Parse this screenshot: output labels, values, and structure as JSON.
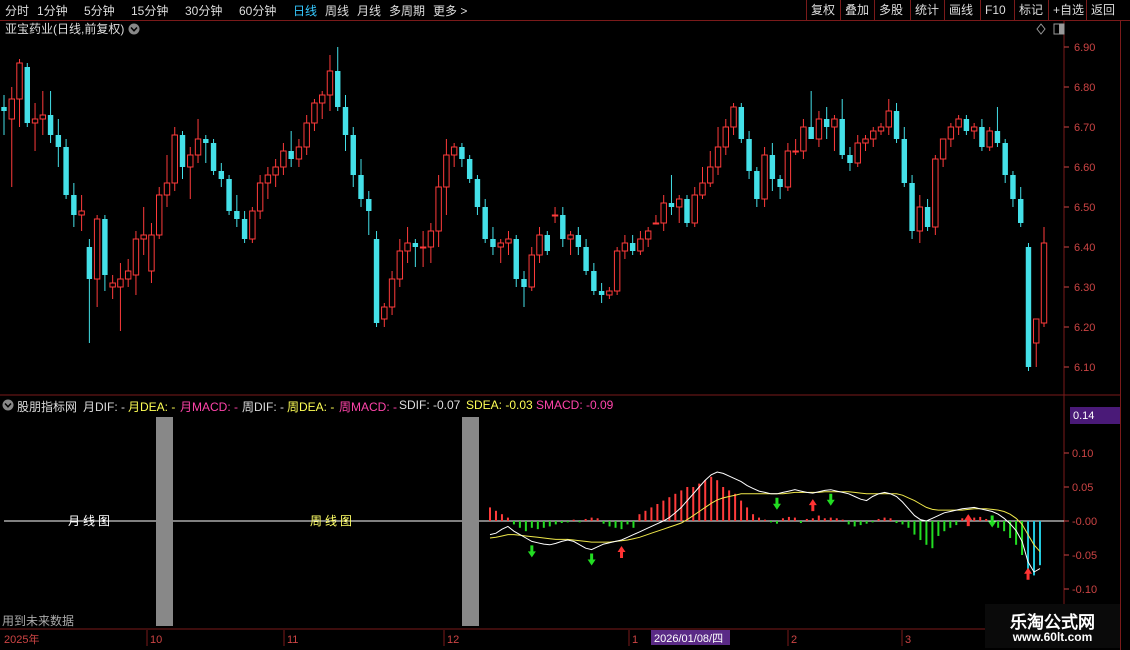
{
  "toolbar": {
    "periods": [
      "分时",
      "1分钟",
      "5分钟",
      "15分钟",
      "30分钟",
      "60分钟",
      "日线",
      "周线",
      "月线",
      "多周期",
      "更多 >"
    ],
    "active_period": "日线",
    "right_buttons": [
      "复权",
      "叠加",
      "多股",
      "统计",
      "画线",
      "F10",
      "标记",
      "+自选",
      "返回"
    ]
  },
  "main_chart": {
    "title": "亚宝药业(日线,前复权)",
    "ylim": [
      6.05,
      6.95
    ],
    "yticks": [
      "6.90",
      "6.80",
      "6.70",
      "6.60",
      "6.50",
      "6.40",
      "6.30",
      "6.20",
      "6.10"
    ]
  },
  "indicator": {
    "name": "股朋指标网",
    "labels": [
      {
        "text": "月DIF: -",
        "color": "#dddddd"
      },
      {
        "text": "月DEA: -",
        "color": "#ffff55"
      },
      {
        "text": "月MACD: -",
        "color": "#ff44aa"
      },
      {
        "text": "周DIF: -",
        "color": "#dddddd"
      },
      {
        "text": "周DEA: -",
        "color": "#ffff55"
      },
      {
        "text": "周MACD: -",
        "color": "#ff44aa"
      },
      {
        "text": "SDIF: -0.07",
        "color": "#dddddd"
      },
      {
        "text": "SDEA: -0.03",
        "color": "#ffff55"
      },
      {
        "text": "SMACD: -0.09",
        "color": "#ff44aa"
      }
    ],
    "yticks": [
      "0.10",
      "0.05",
      "-0.00",
      "-0.05",
      "-0.10"
    ],
    "top_value": "0.14",
    "month_label": "月线图",
    "week_label": "周线图",
    "future_note": "用到未来数据"
  },
  "time_axis": {
    "labels": [
      "2025年",
      "10",
      "11",
      "12",
      "1",
      "2",
      "3"
    ],
    "cursor_date": "2026/01/08/四"
  },
  "watermark": {
    "line1": "乐淘公式网",
    "line2": "www.60lt.com"
  },
  "colors": {
    "up": "#ff3b3b",
    "down": "#44e0e8",
    "bg": "#000000",
    "grid": "#7a1a1a",
    "active": "#35c8ff"
  },
  "chart_data": {
    "type": "candlestick",
    "series": [
      {
        "o": 6.75,
        "h": 6.78,
        "l": 6.68,
        "c": 6.74
      },
      {
        "o": 6.72,
        "h": 6.8,
        "l": 6.55,
        "c": 6.77
      },
      {
        "o": 6.77,
        "h": 6.87,
        "l": 6.7,
        "c": 6.86
      },
      {
        "o": 6.85,
        "h": 6.86,
        "l": 6.7,
        "c": 6.71
      },
      {
        "o": 6.71,
        "h": 6.76,
        "l": 6.64,
        "c": 6.72
      },
      {
        "o": 6.72,
        "h": 6.79,
        "l": 6.68,
        "c": 6.73
      },
      {
        "o": 6.73,
        "h": 6.79,
        "l": 6.66,
        "c": 6.68
      },
      {
        "o": 6.68,
        "h": 6.72,
        "l": 6.6,
        "c": 6.65
      },
      {
        "o": 6.65,
        "h": 6.67,
        "l": 6.52,
        "c": 6.53
      },
      {
        "o": 6.53,
        "h": 6.56,
        "l": 6.45,
        "c": 6.48
      },
      {
        "o": 6.48,
        "h": 6.53,
        "l": 6.44,
        "c": 6.49
      },
      {
        "o": 6.4,
        "h": 6.42,
        "l": 6.16,
        "c": 6.32
      },
      {
        "o": 6.32,
        "h": 6.48,
        "l": 6.25,
        "c": 6.47
      },
      {
        "o": 6.47,
        "h": 6.48,
        "l": 6.29,
        "c": 6.33
      },
      {
        "o": 6.3,
        "h": 6.33,
        "l": 6.27,
        "c": 6.31
      },
      {
        "o": 6.3,
        "h": 6.36,
        "l": 6.19,
        "c": 6.32
      },
      {
        "o": 6.32,
        "h": 6.37,
        "l": 6.3,
        "c": 6.34
      },
      {
        "o": 6.33,
        "h": 6.44,
        "l": 6.28,
        "c": 6.42
      },
      {
        "o": 6.42,
        "h": 6.5,
        "l": 6.38,
        "c": 6.43
      },
      {
        "o": 6.34,
        "h": 6.46,
        "l": 6.31,
        "c": 6.43
      },
      {
        "o": 6.43,
        "h": 6.55,
        "l": 6.42,
        "c": 6.53
      },
      {
        "o": 6.53,
        "h": 6.63,
        "l": 6.5,
        "c": 6.56
      },
      {
        "o": 6.56,
        "h": 6.7,
        "l": 6.54,
        "c": 6.68
      },
      {
        "o": 6.68,
        "h": 6.69,
        "l": 6.57,
        "c": 6.6
      },
      {
        "o": 6.6,
        "h": 6.65,
        "l": 6.52,
        "c": 6.63
      },
      {
        "o": 6.63,
        "h": 6.72,
        "l": 6.61,
        "c": 6.67
      },
      {
        "o": 6.67,
        "h": 6.68,
        "l": 6.61,
        "c": 6.66
      },
      {
        "o": 6.66,
        "h": 6.67,
        "l": 6.58,
        "c": 6.59
      },
      {
        "o": 6.59,
        "h": 6.61,
        "l": 6.55,
        "c": 6.57
      },
      {
        "o": 6.57,
        "h": 6.58,
        "l": 6.48,
        "c": 6.49
      },
      {
        "o": 6.49,
        "h": 6.53,
        "l": 6.45,
        "c": 6.47
      },
      {
        "o": 6.47,
        "h": 6.49,
        "l": 6.41,
        "c": 6.42
      },
      {
        "o": 6.42,
        "h": 6.5,
        "l": 6.41,
        "c": 6.49
      },
      {
        "o": 6.49,
        "h": 6.58,
        "l": 6.47,
        "c": 6.56
      },
      {
        "o": 6.56,
        "h": 6.6,
        "l": 6.52,
        "c": 6.58
      },
      {
        "o": 6.58,
        "h": 6.62,
        "l": 6.55,
        "c": 6.6
      },
      {
        "o": 6.6,
        "h": 6.66,
        "l": 6.58,
        "c": 6.64
      },
      {
        "o": 6.64,
        "h": 6.69,
        "l": 6.6,
        "c": 6.62
      },
      {
        "o": 6.62,
        "h": 6.67,
        "l": 6.6,
        "c": 6.65
      },
      {
        "o": 6.65,
        "h": 6.73,
        "l": 6.63,
        "c": 6.71
      },
      {
        "o": 6.71,
        "h": 6.77,
        "l": 6.69,
        "c": 6.76
      },
      {
        "o": 6.76,
        "h": 6.79,
        "l": 6.72,
        "c": 6.78
      },
      {
        "o": 6.78,
        "h": 6.88,
        "l": 6.74,
        "c": 6.84
      },
      {
        "o": 6.84,
        "h": 6.9,
        "l": 6.74,
        "c": 6.75
      },
      {
        "o": 6.75,
        "h": 6.78,
        "l": 6.64,
        "c": 6.68
      },
      {
        "o": 6.68,
        "h": 6.7,
        "l": 6.55,
        "c": 6.58
      },
      {
        "o": 6.58,
        "h": 6.62,
        "l": 6.5,
        "c": 6.52
      },
      {
        "o": 6.52,
        "h": 6.54,
        "l": 6.43,
        "c": 6.49
      },
      {
        "o": 6.42,
        "h": 6.44,
        "l": 6.2,
        "c": 6.21
      },
      {
        "o": 6.22,
        "h": 6.26,
        "l": 6.2,
        "c": 6.25
      },
      {
        "o": 6.25,
        "h": 6.34,
        "l": 6.23,
        "c": 6.32
      },
      {
        "o": 6.32,
        "h": 6.42,
        "l": 6.3,
        "c": 6.39
      },
      {
        "o": 6.39,
        "h": 6.45,
        "l": 6.36,
        "c": 6.41
      },
      {
        "o": 6.41,
        "h": 6.42,
        "l": 6.35,
        "c": 6.4
      },
      {
        "o": 6.4,
        "h": 6.44,
        "l": 6.35,
        "c": 6.4
      },
      {
        "o": 6.4,
        "h": 6.46,
        "l": 6.36,
        "c": 6.44
      },
      {
        "o": 6.44,
        "h": 6.58,
        "l": 6.4,
        "c": 6.55
      },
      {
        "o": 6.55,
        "h": 6.67,
        "l": 6.48,
        "c": 6.63
      },
      {
        "o": 6.63,
        "h": 6.66,
        "l": 6.6,
        "c": 6.65
      },
      {
        "o": 6.65,
        "h": 6.66,
        "l": 6.6,
        "c": 6.62
      },
      {
        "o": 6.62,
        "h": 6.63,
        "l": 6.56,
        "c": 6.57
      },
      {
        "o": 6.57,
        "h": 6.58,
        "l": 6.48,
        "c": 6.5
      },
      {
        "o": 6.5,
        "h": 6.52,
        "l": 6.41,
        "c": 6.42
      },
      {
        "o": 6.42,
        "h": 6.45,
        "l": 6.38,
        "c": 6.4
      },
      {
        "o": 6.4,
        "h": 6.42,
        "l": 6.36,
        "c": 6.41
      },
      {
        "o": 6.41,
        "h": 6.44,
        "l": 6.38,
        "c": 6.42
      },
      {
        "o": 6.42,
        "h": 6.43,
        "l": 6.3,
        "c": 6.32
      },
      {
        "o": 6.32,
        "h": 6.34,
        "l": 6.25,
        "c": 6.3
      },
      {
        "o": 6.3,
        "h": 6.4,
        "l": 6.29,
        "c": 6.38
      },
      {
        "o": 6.38,
        "h": 6.45,
        "l": 6.36,
        "c": 6.43
      },
      {
        "o": 6.43,
        "h": 6.44,
        "l": 6.38,
        "c": 6.39
      },
      {
        "o": 6.48,
        "h": 6.5,
        "l": 6.46,
        "c": 6.48
      },
      {
        "o": 6.48,
        "h": 6.5,
        "l": 6.4,
        "c": 6.42
      },
      {
        "o": 6.42,
        "h": 6.44,
        "l": 6.38,
        "c": 6.43
      },
      {
        "o": 6.43,
        "h": 6.45,
        "l": 6.38,
        "c": 6.4
      },
      {
        "o": 6.4,
        "h": 6.42,
        "l": 6.33,
        "c": 6.34
      },
      {
        "o": 6.34,
        "h": 6.36,
        "l": 6.28,
        "c": 6.29
      },
      {
        "o": 6.29,
        "h": 6.31,
        "l": 6.26,
        "c": 6.28
      },
      {
        "o": 6.28,
        "h": 6.3,
        "l": 6.27,
        "c": 6.29
      },
      {
        "o": 6.29,
        "h": 6.4,
        "l": 6.28,
        "c": 6.39
      },
      {
        "o": 6.39,
        "h": 6.43,
        "l": 6.37,
        "c": 6.41
      },
      {
        "o": 6.41,
        "h": 6.43,
        "l": 6.38,
        "c": 6.39
      },
      {
        "o": 6.39,
        "h": 6.44,
        "l": 6.38,
        "c": 6.42
      },
      {
        "o": 6.42,
        "h": 6.45,
        "l": 6.4,
        "c": 6.44
      },
      {
        "o": 6.46,
        "h": 6.48,
        "l": 6.46,
        "c": 6.46
      },
      {
        "o": 6.46,
        "h": 6.53,
        "l": 6.44,
        "c": 6.51
      },
      {
        "o": 6.51,
        "h": 6.58,
        "l": 6.48,
        "c": 6.5
      },
      {
        "o": 6.5,
        "h": 6.53,
        "l": 6.46,
        "c": 6.52
      },
      {
        "o": 6.52,
        "h": 6.53,
        "l": 6.45,
        "c": 6.46
      },
      {
        "o": 6.46,
        "h": 6.55,
        "l": 6.45,
        "c": 6.53
      },
      {
        "o": 6.53,
        "h": 6.6,
        "l": 6.52,
        "c": 6.56
      },
      {
        "o": 6.56,
        "h": 6.64,
        "l": 6.55,
        "c": 6.6
      },
      {
        "o": 6.6,
        "h": 6.7,
        "l": 6.58,
        "c": 6.65
      },
      {
        "o": 6.65,
        "h": 6.72,
        "l": 6.63,
        "c": 6.7
      },
      {
        "o": 6.7,
        "h": 6.76,
        "l": 6.68,
        "c": 6.75
      },
      {
        "o": 6.75,
        "h": 6.76,
        "l": 6.66,
        "c": 6.67
      },
      {
        "o": 6.67,
        "h": 6.69,
        "l": 6.57,
        "c": 6.59
      },
      {
        "o": 6.59,
        "h": 6.6,
        "l": 6.5,
        "c": 6.52
      },
      {
        "o": 6.52,
        "h": 6.65,
        "l": 6.5,
        "c": 6.63
      },
      {
        "o": 6.63,
        "h": 6.66,
        "l": 6.54,
        "c": 6.57
      },
      {
        "o": 6.57,
        "h": 6.58,
        "l": 6.52,
        "c": 6.55
      },
      {
        "o": 6.55,
        "h": 6.66,
        "l": 6.54,
        "c": 6.64
      },
      {
        "o": 6.64,
        "h": 6.67,
        "l": 6.63,
        "c": 6.64
      },
      {
        "o": 6.64,
        "h": 6.72,
        "l": 6.62,
        "c": 6.7
      },
      {
        "o": 6.7,
        "h": 6.79,
        "l": 6.67,
        "c": 6.67
      },
      {
        "o": 6.67,
        "h": 6.74,
        "l": 6.65,
        "c": 6.72
      },
      {
        "o": 6.72,
        "h": 6.75,
        "l": 6.67,
        "c": 6.7
      },
      {
        "o": 6.7,
        "h": 6.73,
        "l": 6.64,
        "c": 6.72
      },
      {
        "o": 6.72,
        "h": 6.77,
        "l": 6.62,
        "c": 6.63
      },
      {
        "o": 6.63,
        "h": 6.65,
        "l": 6.59,
        "c": 6.61
      },
      {
        "o": 6.61,
        "h": 6.68,
        "l": 6.6,
        "c": 6.66
      },
      {
        "o": 6.66,
        "h": 6.68,
        "l": 6.64,
        "c": 6.67
      },
      {
        "o": 6.67,
        "h": 6.7,
        "l": 6.65,
        "c": 6.69
      },
      {
        "o": 6.69,
        "h": 6.71,
        "l": 6.68,
        "c": 6.7
      },
      {
        "o": 6.7,
        "h": 6.77,
        "l": 6.68,
        "c": 6.74
      },
      {
        "o": 6.74,
        "h": 6.76,
        "l": 6.66,
        "c": 6.67
      },
      {
        "o": 6.67,
        "h": 6.7,
        "l": 6.55,
        "c": 6.56
      },
      {
        "o": 6.56,
        "h": 6.58,
        "l": 6.42,
        "c": 6.44
      },
      {
        "o": 6.44,
        "h": 6.53,
        "l": 6.41,
        "c": 6.5
      },
      {
        "o": 6.5,
        "h": 6.52,
        "l": 6.44,
        "c": 6.45
      },
      {
        "o": 6.45,
        "h": 6.63,
        "l": 6.43,
        "c": 6.62
      },
      {
        "o": 6.62,
        "h": 6.67,
        "l": 6.6,
        "c": 6.67
      },
      {
        "o": 6.67,
        "h": 6.71,
        "l": 6.65,
        "c": 6.7
      },
      {
        "o": 6.7,
        "h": 6.73,
        "l": 6.68,
        "c": 6.72
      },
      {
        "o": 6.72,
        "h": 6.73,
        "l": 6.68,
        "c": 6.69
      },
      {
        "o": 6.69,
        "h": 6.71,
        "l": 6.67,
        "c": 6.7
      },
      {
        "o": 6.7,
        "h": 6.72,
        "l": 6.64,
        "c": 6.65
      },
      {
        "o": 6.65,
        "h": 6.7,
        "l": 6.64,
        "c": 6.69
      },
      {
        "o": 6.69,
        "h": 6.75,
        "l": 6.65,
        "c": 6.66
      },
      {
        "o": 6.66,
        "h": 6.67,
        "l": 6.56,
        "c": 6.58
      },
      {
        "o": 6.58,
        "h": 6.59,
        "l": 6.5,
        "c": 6.52
      },
      {
        "o": 6.52,
        "h": 6.55,
        "l": 6.45,
        "c": 6.46
      },
      {
        "o": 6.4,
        "h": 6.41,
        "l": 6.09,
        "c": 6.1
      },
      {
        "o": 6.16,
        "h": 6.22,
        "l": 6.1,
        "c": 6.22
      },
      {
        "o": 6.21,
        "h": 6.45,
        "l": 6.2,
        "c": 6.41
      }
    ],
    "macd_hist": [
      0.02,
      0.015,
      0.01,
      0.005,
      -0.005,
      -0.01,
      -0.015,
      -0.01,
      -0.012,
      -0.01,
      -0.008,
      -0.005,
      -0.003,
      -0.002,
      0.002,
      -0.002,
      0.003,
      0.005,
      0.004,
      -0.004,
      -0.008,
      -0.01,
      -0.012,
      -0.005,
      -0.01,
      0.01,
      0.015,
      0.02,
      0.025,
      0.03,
      0.035,
      0.04,
      0.045,
      0.05,
      0.05,
      0.055,
      0.06,
      0.065,
      0.06,
      0.05,
      0.045,
      0.04,
      0.03,
      0.02,
      0.01,
      0.005,
      0.002,
      -0.002,
      -0.004,
      0.004,
      0.006,
      0.005,
      -0.003,
      0.003,
      0.004,
      0.008,
      0.004,
      0.005,
      0.004,
      0.002,
      -0.005,
      -0.008,
      -0.006,
      -0.004,
      -0.002,
      0.003,
      0.005,
      0.004,
      -0.003,
      -0.005,
      -0.01,
      -0.02,
      -0.028,
      -0.035,
      -0.04,
      -0.022,
      -0.015,
      -0.01,
      -0.006,
      0.004,
      0.008,
      0.005,
      0.006,
      0.003,
      -0.002,
      -0.01,
      -0.015,
      -0.025,
      -0.035,
      -0.05,
      -0.075,
      -0.08,
      -0.065
    ],
    "sdif": [
      -0.02,
      -0.018,
      -0.012,
      -0.008,
      -0.015,
      -0.02,
      -0.025,
      -0.03,
      -0.032,
      -0.034,
      -0.035,
      -0.033,
      -0.03,
      -0.028,
      -0.03,
      -0.035,
      -0.04,
      -0.042,
      -0.038,
      -0.034,
      -0.032,
      -0.03,
      -0.028,
      -0.024,
      -0.02,
      -0.016,
      -0.012,
      -0.008,
      -0.004,
      0,
      0.005,
      0.012,
      0.02,
      0.03,
      0.04,
      0.05,
      0.06,
      0.068,
      0.072,
      0.07,
      0.066,
      0.062,
      0.058,
      0.052,
      0.048,
      0.044,
      0.042,
      0.04,
      0.04,
      0.042,
      0.044,
      0.046,
      0.044,
      0.042,
      0.041,
      0.043,
      0.045,
      0.046,
      0.044,
      0.042,
      0.04,
      0.036,
      0.032,
      0.03,
      0.036,
      0.04,
      0.042,
      0.04,
      0.036,
      0.028,
      0.018,
      0.008,
      0.002,
      0,
      0.004,
      0.008,
      0.012,
      0.014,
      0.016,
      0.018,
      0.019,
      0.02,
      0.018,
      0.016,
      0.014,
      0.01,
      0.004,
      -0.004,
      -0.014,
      -0.03,
      -0.06,
      -0.075,
      -0.07
    ],
    "sdea": [
      -0.025,
      -0.024,
      -0.022,
      -0.02,
      -0.02,
      -0.021,
      -0.022,
      -0.023,
      -0.024,
      -0.025,
      -0.026,
      -0.027,
      -0.027,
      -0.027,
      -0.028,
      -0.029,
      -0.03,
      -0.031,
      -0.031,
      -0.031,
      -0.031,
      -0.03,
      -0.029,
      -0.028,
      -0.026,
      -0.024,
      -0.021,
      -0.018,
      -0.015,
      -0.012,
      -0.009,
      -0.006,
      -0.003,
      0.002,
      0.008,
      0.014,
      0.02,
      0.026,
      0.031,
      0.034,
      0.036,
      0.038,
      0.04,
      0.04,
      0.04,
      0.04,
      0.04,
      0.04,
      0.04,
      0.04,
      0.041,
      0.042,
      0.042,
      0.042,
      0.042,
      0.042,
      0.043,
      0.043,
      0.043,
      0.043,
      0.043,
      0.042,
      0.041,
      0.04,
      0.04,
      0.04,
      0.04,
      0.04,
      0.04,
      0.038,
      0.034,
      0.03,
      0.025,
      0.02,
      0.017,
      0.016,
      0.016,
      0.016,
      0.016,
      0.016,
      0.017,
      0.018,
      0.018,
      0.018,
      0.017,
      0.016,
      0.014,
      0.01,
      0.004,
      -0.005,
      -0.02,
      -0.035,
      -0.045
    ],
    "buy_signals_at": [
      22,
      54,
      80,
      90
    ],
    "sell_signals_at": [
      7,
      17,
      48,
      57,
      84
    ]
  }
}
